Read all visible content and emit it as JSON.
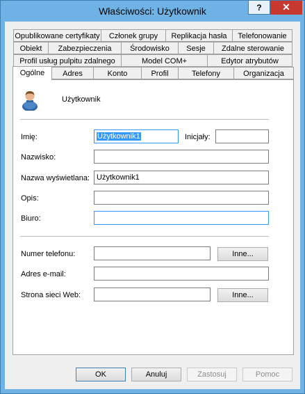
{
  "window": {
    "title": "Właściwości: Użytkownik",
    "help_glyph": "?",
    "close_glyph": "✕"
  },
  "tabs": {
    "row1": [
      "Opublikowane certyfikaty",
      "Członek grupy",
      "Replikacja hasła",
      "Telefonowanie"
    ],
    "row2": [
      "Obiekt",
      "Zabezpieczenia",
      "Środowisko",
      "Sesje",
      "Zdalne sterowanie"
    ],
    "row3": [
      "Profil usług pulpitu zdalnego",
      "Model COM+",
      "Edytor atrybutów"
    ],
    "row4": [
      "Ogólne",
      "Adres",
      "Konto",
      "Profil",
      "Telefony",
      "Organizacja"
    ],
    "active": "Ogólne"
  },
  "general": {
    "object_name": "Użytkownik",
    "avatar_icon": "user-icon",
    "first_name_label": "Imię:",
    "first_name_value": "Użytkownik1",
    "initials_label": "Inicjały:",
    "initials_value": "",
    "last_name_label": "Nazwisko:",
    "last_name_value": "",
    "display_name_label": "Nazwa wyświetlana:",
    "display_name_value": "Użytkownik1",
    "description_label": "Opis:",
    "description_value": "",
    "office_label": "Biuro:",
    "office_value": "",
    "phone_label": "Numer telefonu:",
    "phone_value": "",
    "phone_other_label": "Inne...",
    "email_label": "Adres e-mail:",
    "email_value": "",
    "web_label": "Strona sieci Web:",
    "web_value": "",
    "web_other_label": "Inne..."
  },
  "footer": {
    "ok": "OK",
    "cancel": "Anuluj",
    "apply": "Zastosuj",
    "help": "Pomoc"
  }
}
